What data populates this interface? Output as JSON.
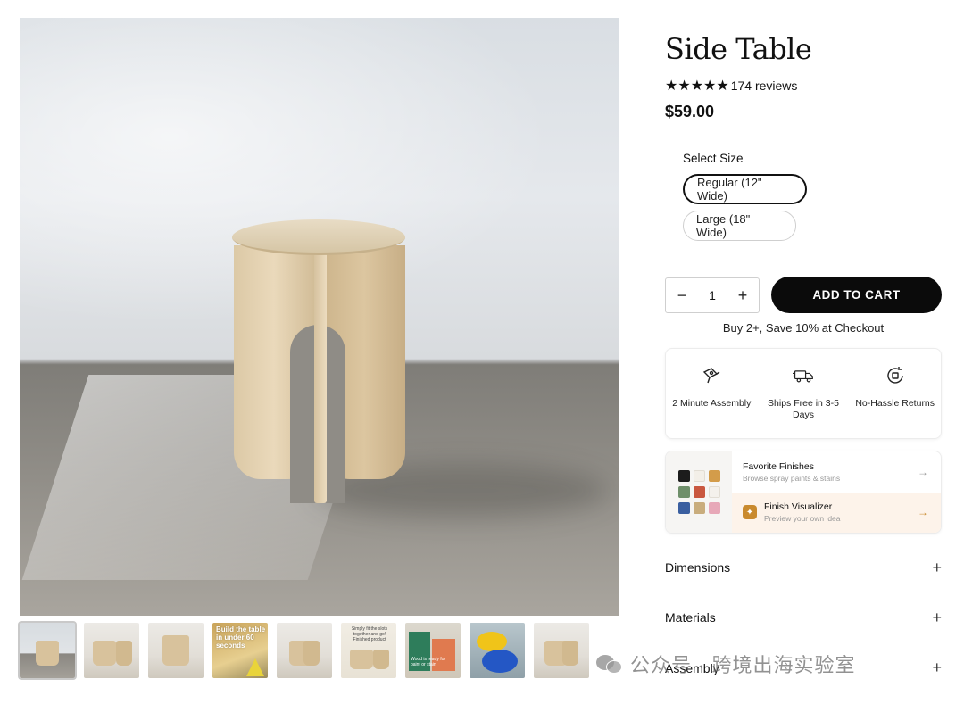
{
  "product": {
    "title": "Side Table",
    "stars": "★★★★★",
    "reviews": "174 reviews",
    "price": "$59.00"
  },
  "size": {
    "label": "Select Size",
    "options": [
      "Regular (12\" Wide)",
      "Large (18\" Wide)"
    ],
    "selected_index": 0
  },
  "cart": {
    "minus": "−",
    "quantity": "1",
    "plus": "+",
    "add_label": "ADD TO CART",
    "promo": "Buy 2+, Save 10% at Checkout"
  },
  "features": [
    {
      "label": "2 Minute Assembly",
      "icon": "drill-icon"
    },
    {
      "label": "Ships Free in 3-5 Days",
      "icon": "truck-icon"
    },
    {
      "label": "No-Hassle Returns",
      "icon": "return-icon"
    }
  ],
  "finishes": {
    "swatches": [
      "#1c1c1c",
      "#f3efe8",
      "#d39c4a",
      "#6f8f6a",
      "#c9573f",
      "#f4f1ec",
      "#3a5fa0",
      "#c9ad7d",
      "#e7a8b8"
    ],
    "items": [
      {
        "title": "Favorite Finishes",
        "subtitle": "Browse spray paints & stains",
        "arrow": "→"
      },
      {
        "title": "Finish Visualizer",
        "subtitle": "Preview your own idea",
        "arrow": "→"
      }
    ]
  },
  "accordions": [
    {
      "label": "Dimensions",
      "icon": "+"
    },
    {
      "label": "Materials",
      "icon": "+"
    },
    {
      "label": "Assembly",
      "icon": "+"
    }
  ],
  "thumbnails": {
    "t4_text": "Build the table in under 60 seconds",
    "t6_text": "Simply fit the slots together and go! Finished product",
    "t7_text": "Wood is ready for paint or stain"
  },
  "watermark": {
    "text": "公众号 · 跨境出海实验室"
  }
}
